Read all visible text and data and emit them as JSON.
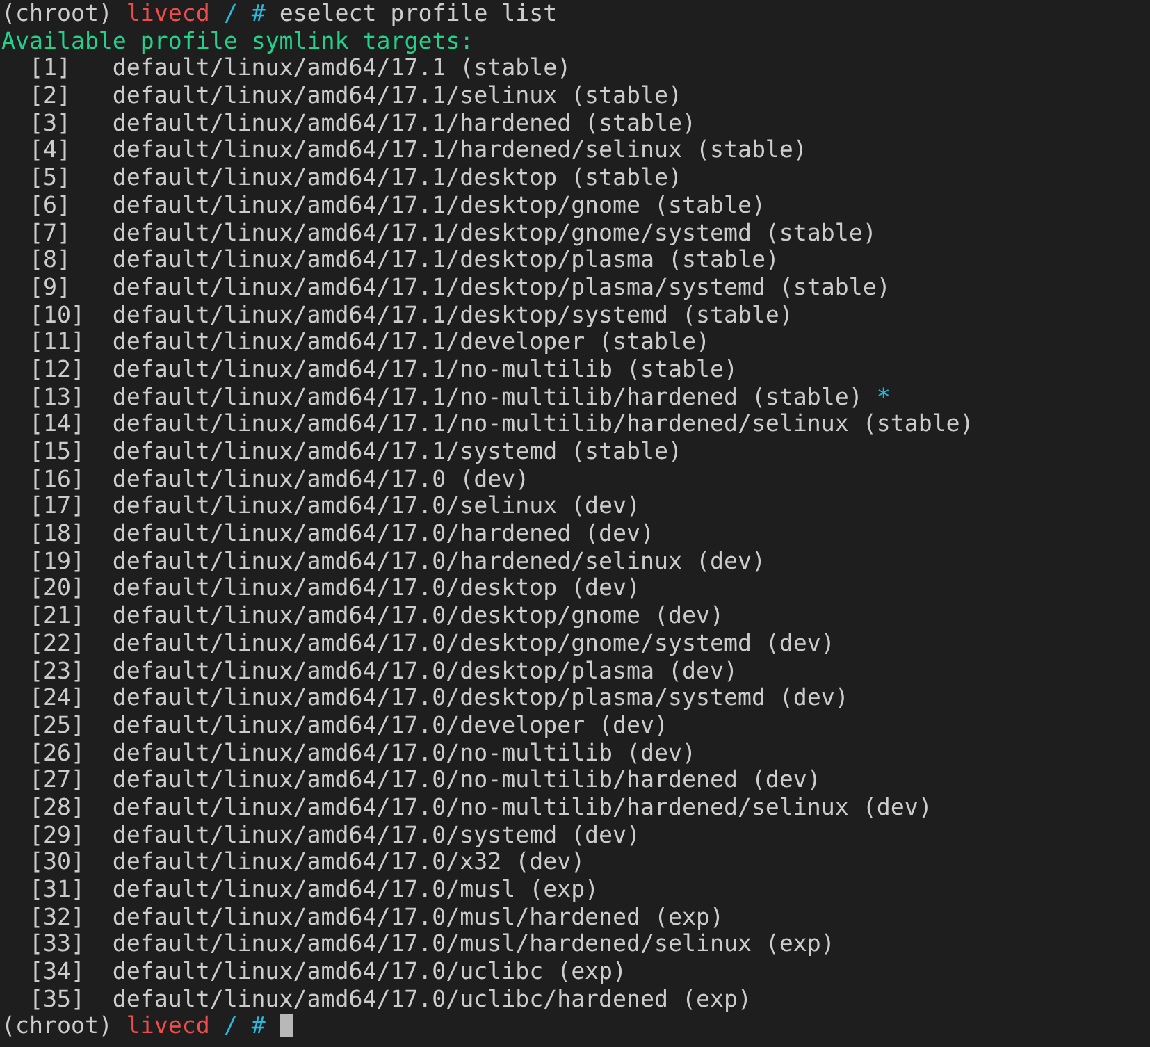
{
  "prompt": {
    "env": "(chroot)",
    "host": "livecd",
    "path": "/ #"
  },
  "command": "eselect profile list",
  "heading": "Available profile symlink targets:",
  "selected_marker": "*",
  "profiles": [
    {
      "index": "[1]",
      "target": "default/linux/amd64/17.1 (stable)",
      "selected": false
    },
    {
      "index": "[2]",
      "target": "default/linux/amd64/17.1/selinux (stable)",
      "selected": false
    },
    {
      "index": "[3]",
      "target": "default/linux/amd64/17.1/hardened (stable)",
      "selected": false
    },
    {
      "index": "[4]",
      "target": "default/linux/amd64/17.1/hardened/selinux (stable)",
      "selected": false
    },
    {
      "index": "[5]",
      "target": "default/linux/amd64/17.1/desktop (stable)",
      "selected": false
    },
    {
      "index": "[6]",
      "target": "default/linux/amd64/17.1/desktop/gnome (stable)",
      "selected": false
    },
    {
      "index": "[7]",
      "target": "default/linux/amd64/17.1/desktop/gnome/systemd (stable)",
      "selected": false
    },
    {
      "index": "[8]",
      "target": "default/linux/amd64/17.1/desktop/plasma (stable)",
      "selected": false
    },
    {
      "index": "[9]",
      "target": "default/linux/amd64/17.1/desktop/plasma/systemd (stable)",
      "selected": false
    },
    {
      "index": "[10]",
      "target": "default/linux/amd64/17.1/desktop/systemd (stable)",
      "selected": false
    },
    {
      "index": "[11]",
      "target": "default/linux/amd64/17.1/developer (stable)",
      "selected": false
    },
    {
      "index": "[12]",
      "target": "default/linux/amd64/17.1/no-multilib (stable)",
      "selected": false
    },
    {
      "index": "[13]",
      "target": "default/linux/amd64/17.1/no-multilib/hardened (stable)",
      "selected": true
    },
    {
      "index": "[14]",
      "target": "default/linux/amd64/17.1/no-multilib/hardened/selinux (stable)",
      "selected": false
    },
    {
      "index": "[15]",
      "target": "default/linux/amd64/17.1/systemd (stable)",
      "selected": false
    },
    {
      "index": "[16]",
      "target": "default/linux/amd64/17.0 (dev)",
      "selected": false
    },
    {
      "index": "[17]",
      "target": "default/linux/amd64/17.0/selinux (dev)",
      "selected": false
    },
    {
      "index": "[18]",
      "target": "default/linux/amd64/17.0/hardened (dev)",
      "selected": false
    },
    {
      "index": "[19]",
      "target": "default/linux/amd64/17.0/hardened/selinux (dev)",
      "selected": false
    },
    {
      "index": "[20]",
      "target": "default/linux/amd64/17.0/desktop (dev)",
      "selected": false
    },
    {
      "index": "[21]",
      "target": "default/linux/amd64/17.0/desktop/gnome (dev)",
      "selected": false
    },
    {
      "index": "[22]",
      "target": "default/linux/amd64/17.0/desktop/gnome/systemd (dev)",
      "selected": false
    },
    {
      "index": "[23]",
      "target": "default/linux/amd64/17.0/desktop/plasma (dev)",
      "selected": false
    },
    {
      "index": "[24]",
      "target": "default/linux/amd64/17.0/desktop/plasma/systemd (dev)",
      "selected": false
    },
    {
      "index": "[25]",
      "target": "default/linux/amd64/17.0/developer (dev)",
      "selected": false
    },
    {
      "index": "[26]",
      "target": "default/linux/amd64/17.0/no-multilib (dev)",
      "selected": false
    },
    {
      "index": "[27]",
      "target": "default/linux/amd64/17.0/no-multilib/hardened (dev)",
      "selected": false
    },
    {
      "index": "[28]",
      "target": "default/linux/amd64/17.0/no-multilib/hardened/selinux (dev)",
      "selected": false
    },
    {
      "index": "[29]",
      "target": "default/linux/amd64/17.0/systemd (dev)",
      "selected": false
    },
    {
      "index": "[30]",
      "target": "default/linux/amd64/17.0/x32 (dev)",
      "selected": false
    },
    {
      "index": "[31]",
      "target": "default/linux/amd64/17.0/musl (exp)",
      "selected": false
    },
    {
      "index": "[32]",
      "target": "default/linux/amd64/17.0/musl/hardened (exp)",
      "selected": false
    },
    {
      "index": "[33]",
      "target": "default/linux/amd64/17.0/musl/hardened/selinux (exp)",
      "selected": false
    },
    {
      "index": "[34]",
      "target": "default/linux/amd64/17.0/uclibc (exp)",
      "selected": false
    },
    {
      "index": "[35]",
      "target": "default/linux/amd64/17.0/uclibc/hardened (exp)",
      "selected": false
    }
  ],
  "final_prompt": {
    "env": "(chroot)",
    "host": "livecd",
    "path": "/ #"
  }
}
